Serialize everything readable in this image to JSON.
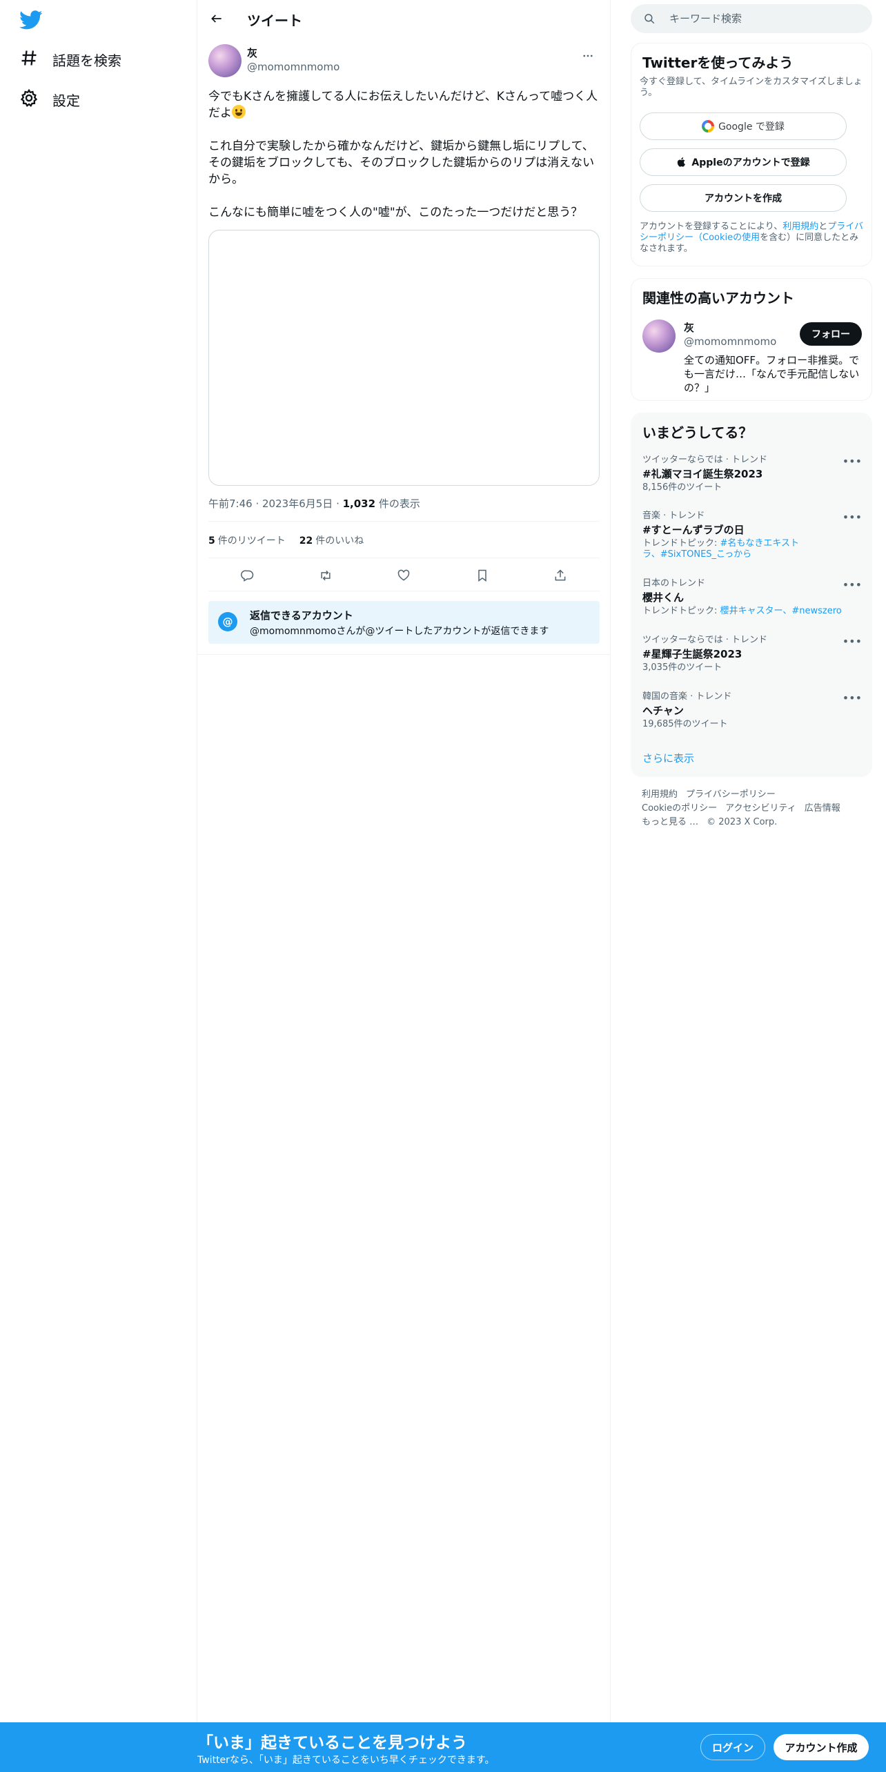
{
  "nav": {
    "logo": "twitter-bird-icon",
    "items": [
      {
        "label": "話題を検索",
        "icon": "hashtag-icon"
      },
      {
        "label": "設定",
        "icon": "gear-icon"
      }
    ]
  },
  "main": {
    "title": "ツイート",
    "author": {
      "name": "灰",
      "handle": "@momomnmomo"
    },
    "text": {
      "p1": "今でもKさんを擁護してる人にお伝えしたいんだけど、Kさんって嘘つく人だよ",
      "p2": "これ自分で実験したから確かなんだけど、鍵垢から鍵無し垢にリプして、その鍵垢をブロックしても、そのブロックした鍵垢からのリプは消えないから。",
      "p3": "こんなにも簡単に嘘をつく人の\"嘘\"が、このたった一つだけだと思う？"
    },
    "meta": {
      "time": "午前7:46",
      "date": "2023年6月5日",
      "views_count": "1,032",
      "views_label": "件の表示"
    },
    "stats": {
      "retweets_count": "5",
      "retweets_label": "件のリツイート",
      "likes_count": "22",
      "likes_label": "件のいいね"
    },
    "actions": [
      "reply-icon",
      "retweet-icon",
      "like-icon",
      "bookmark-icon",
      "share-icon"
    ],
    "reply_box": {
      "icon": "@",
      "title": "返信できるアカウント",
      "subtitle": "@momomnmomoさんが@ツイートしたアカウントが返信できます"
    }
  },
  "right": {
    "search_placeholder": "キーワード検索",
    "signup": {
      "title": "Twitterを使ってみよう",
      "subtitle": "今すぐ登録して、タイムラインをカスタマイズしましょう。",
      "google": "Google で登録",
      "apple": "Appleのアカウントで登録",
      "create": "アカウントを作成",
      "terms_pre": "アカウントを登録することにより、",
      "terms_link1": "利用規約",
      "terms_and": "と",
      "terms_link2": "プライバシーポリシー（Cookieの使用",
      "terms_post": "を含む）に同意したとみなされます。"
    },
    "related": {
      "title": "関連性の高いアカウント",
      "name": "灰",
      "handle": "@momomnmomo",
      "follow": "フォロー",
      "bio": "全ての通知OFF。フォロー非推奨。でも一言だけ…「なんで手元配信しないの？」"
    },
    "trends": {
      "title": "いまどうしてる？",
      "items": [
        {
          "category": "ツイッターならでは · トレンド",
          "name": "#礼瀬マヨイ誕生祭2023",
          "sub": "8,156件のツイート"
        },
        {
          "category": "音楽 · トレンド",
          "name": "#すとーんずラブの日",
          "sub_pre": "トレンドトピック: ",
          "sub_link": "#名もなきエキストラ、#SixTONES_こっから"
        },
        {
          "category": "日本のトレンド",
          "name": "櫻井くん",
          "sub_pre": "トレンドトピック: ",
          "sub_link": "櫻井キャスター、#newszero"
        },
        {
          "category": "ツイッターならでは · トレンド",
          "name": "#星輝子生誕祭2023",
          "sub": "3,035件のツイート"
        },
        {
          "category": "韓国の音楽 · トレンド",
          "name": "ヘチャン",
          "sub": "19,685件のツイート"
        }
      ],
      "show_more": "さらに表示"
    },
    "footer": {
      "terms": "利用規約",
      "privacy": "プライバシーポリシー",
      "cookie": "Cookieのポリシー",
      "accessibility": "アクセシビリティ",
      "ads": "広告情報",
      "more": "もっと見る …",
      "copyright": "© 2023 X Corp."
    }
  },
  "banner": {
    "title": "「いま」起きていることを見つけよう",
    "subtitle": "Twitterなら、「いま」起きていることをいち早くチェックできます。",
    "login": "ログイン",
    "signup": "アカウント作成"
  },
  "colors": {
    "brand": "#1d9bf0",
    "text": "#0f1419",
    "muted": "#536471"
  }
}
